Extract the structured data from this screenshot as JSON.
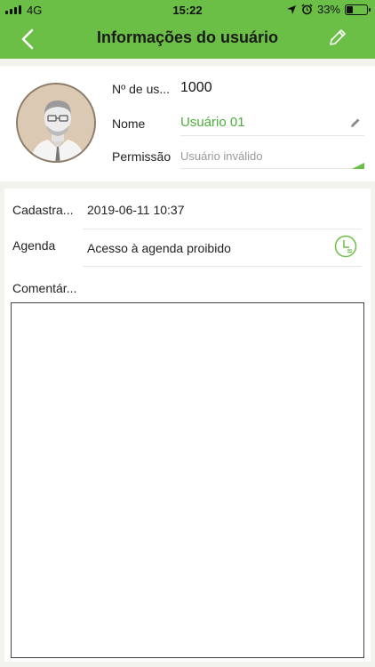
{
  "status_bar": {
    "carrier": "4G",
    "time": "15:22",
    "battery": "33%",
    "battery_level": 0.33
  },
  "header": {
    "title": "Informações do usuário",
    "back_icon": "chevron-left-icon",
    "edit_icon": "pencil-icon"
  },
  "profile": {
    "avatar": "user-avatar",
    "user_number_label": "Nº de us...",
    "user_number": "1000",
    "name_label": "Nome",
    "name": "Usuário 01",
    "permission_label": "Permissão",
    "permission": "Usuário inválido"
  },
  "details": {
    "registered_label": "Cadastra...",
    "registered_value": "2019-06-11 10:37",
    "schedule_label": "Agenda",
    "schedule_value": "Acesso à agenda proibido",
    "schedule_icon": "clock-icon",
    "comment_label": "Comentár...",
    "comment_value": ""
  },
  "colors": {
    "accent": "#6bbf47",
    "name_text": "#4caf3a",
    "background": "#f3f3ee"
  }
}
